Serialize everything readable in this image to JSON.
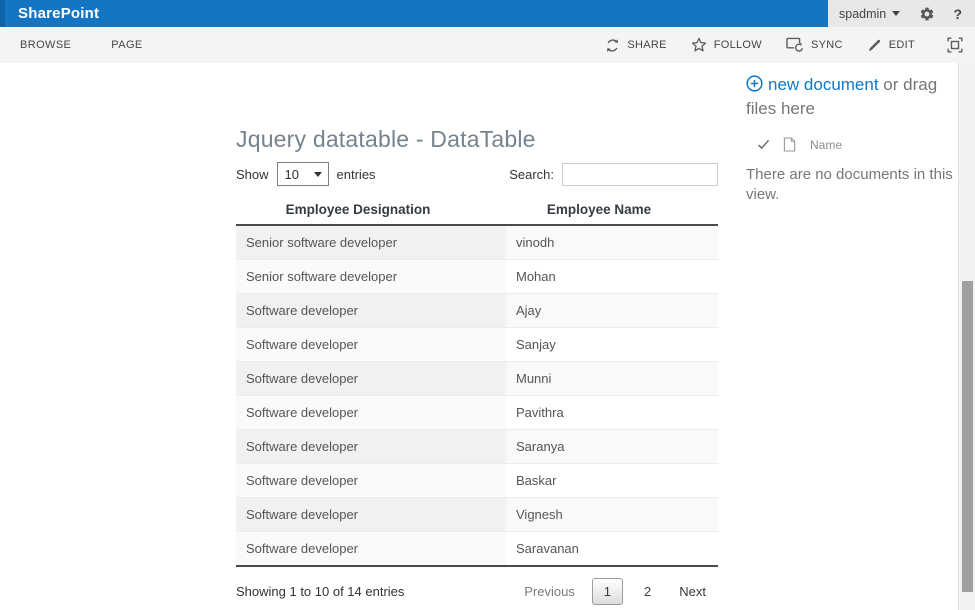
{
  "suite_bar": {
    "brand": "SharePoint",
    "user": "spadmin",
    "help": "?"
  },
  "ribbon": {
    "tabs": [
      {
        "label": "BROWSE"
      },
      {
        "label": "PAGE"
      }
    ],
    "actions": [
      {
        "label": "SHARE"
      },
      {
        "label": "FOLLOW"
      },
      {
        "label": "SYNC"
      },
      {
        "label": "EDIT"
      }
    ]
  },
  "datatable": {
    "title": "Jquery datatable - DataTable",
    "length": {
      "label_before": "Show",
      "value": "10",
      "label_after": "entries"
    },
    "search_label": "Search:",
    "search_value": "",
    "columns": [
      "Employee Designation",
      "Employee Name"
    ],
    "rows": [
      [
        "Senior software developer",
        "vinodh"
      ],
      [
        "Senior software developer",
        "Mohan"
      ],
      [
        "Software developer",
        "Ajay"
      ],
      [
        "Software developer",
        "Sanjay"
      ],
      [
        "Software developer",
        "Munni"
      ],
      [
        "Software developer",
        "Pavithra"
      ],
      [
        "Software developer",
        "Saranya"
      ],
      [
        "Software developer",
        "Baskar"
      ],
      [
        "Software developer",
        "Vignesh"
      ],
      [
        "Software developer",
        "Saravanan"
      ]
    ],
    "info": "Showing 1 to 10 of 14 entries",
    "pagination": {
      "previous": "Previous",
      "pages": [
        "1",
        "2"
      ],
      "active_page": "1",
      "next": "Next"
    }
  },
  "doc_panel": {
    "new_link": "new document",
    "drag_text": " or drag files here",
    "name_column": "Name",
    "empty_message": "There are no documents in this view."
  },
  "colors": {
    "suite_bar_blue": "#1575c5",
    "suite_bar_edge": "#0e63a9",
    "link_blue": "#0b79cb",
    "ribbon_bg": "#f4f4f4",
    "stripe_sorted": "#f1f1f1",
    "stripe": "#f9f9f9",
    "header_border": "#4a4a4a"
  }
}
